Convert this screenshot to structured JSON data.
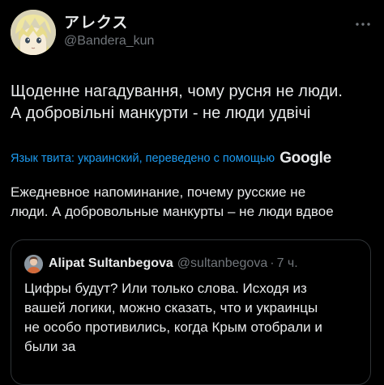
{
  "author": {
    "display_name": "アレクス",
    "handle": "@Bandera_kun",
    "avatar_icon": "anime-character-avatar-icon"
  },
  "tweet": {
    "text_line1": "Щоденне нагадування, чому русня не люди.",
    "text_line2": "А добровільні манкурти - не люди удвічі"
  },
  "translation": {
    "label": "Язык твита: украинский, переведено с помощью",
    "provider": "Google",
    "text_line1": "Ежедневное напоминание, почему русские не",
    "text_line2": "люди. А добровольные манкурты – не люди вдвое"
  },
  "quoted_tweet": {
    "display_name": "Alipat Sultanbegova",
    "handle": "@sultanbegova",
    "separator": "·",
    "time": "7 ч.",
    "text_line1": "Цифры будут? Или только слова. Исходя из",
    "text_line2": "вашей логики, можно сказать, что и украинцы",
    "text_line3": "не особо противились, когда Крым отобрали и",
    "text_line4": "были за"
  },
  "colors": {
    "background": "#000000",
    "text": "#e7e9ea",
    "secondary": "#71767b",
    "link": "#1d9bf0",
    "border": "#2f3336"
  }
}
